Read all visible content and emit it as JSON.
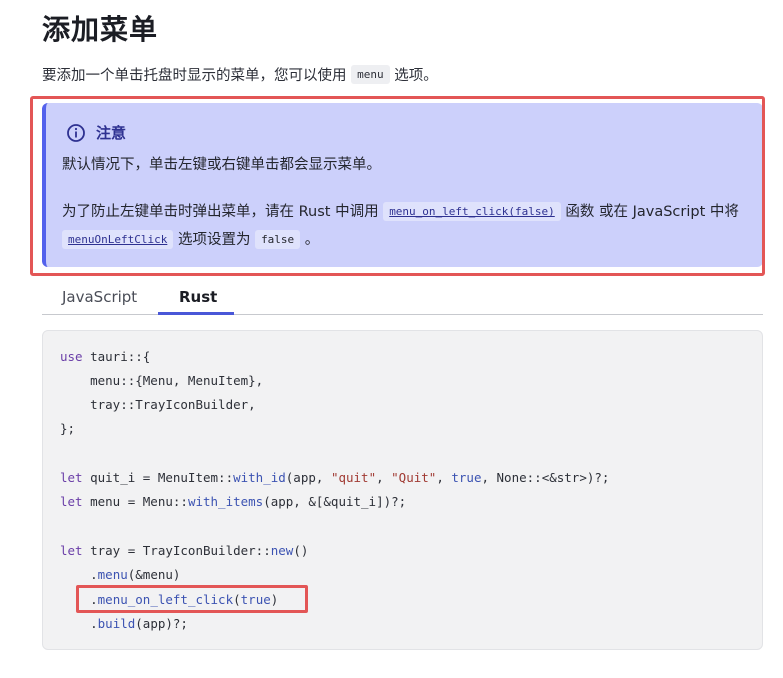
{
  "heading": "添加菜单",
  "intro": {
    "before": "要添加一个单击托盘时显示的菜单，您可以使用",
    "code": "menu",
    "after": "选项。"
  },
  "note": {
    "title": "注意",
    "p1": "默认情况下，单击左键或右键单击都会显示菜单。",
    "p2_a": "为了防止左键单击时弹出菜单，请在 Rust 中调用",
    "p2_code1": "menu_on_left_click(false)",
    "p2_b": "函数 或在 JavaScript 中将",
    "p2_code2": "menuOnLeftClick",
    "p2_c": "选项设置为",
    "p2_code3": "false",
    "p2_d": "。",
    "colors": {
      "background": "#ccd0fb",
      "accent": "#5361ec",
      "outline": "#e35656"
    },
    "icon": "info-icon"
  },
  "tabs": [
    {
      "label": "JavaScript",
      "active": false
    },
    {
      "label": "Rust",
      "active": true
    }
  ],
  "code": {
    "language": "rust",
    "lines": [
      "use tauri::{",
      "    menu::{Menu, MenuItem},",
      "    tray::TrayIconBuilder,",
      "};",
      "",
      "let quit_i = MenuItem::with_id(app, \"quit\", \"Quit\", true, None::<&str>)?;",
      "let menu = Menu::with_items(app, &[&quit_i])?;",
      "",
      "let tray = TrayIconBuilder::new()",
      "    .menu(&menu)",
      "    .menu_on_left_click(true)",
      "    .build(app)?;"
    ],
    "highlighted_line": ".menu_on_left_click(true)"
  }
}
